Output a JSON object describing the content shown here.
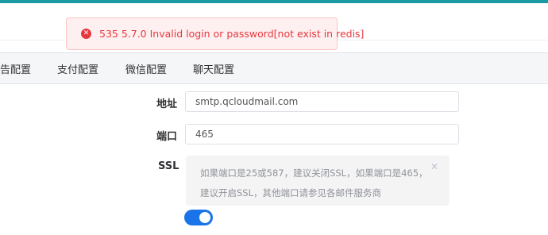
{
  "message": {
    "text": "535 5.7.0 Invalid login or password[not exist in redis]",
    "icon": "error-circle-icon",
    "color": "#e6393f"
  },
  "tabs": [
    {
      "label": "告配置"
    },
    {
      "label": "支付配置"
    },
    {
      "label": "微信配置"
    },
    {
      "label": "聊天配置"
    }
  ],
  "form": {
    "address": {
      "label": "地址",
      "value": "smtp.qcloudmail.com"
    },
    "port": {
      "label": "端口",
      "value": "465"
    },
    "ssl": {
      "label": "SSL",
      "hint": "如果端口是25或587，建议关闭SSL，如果端口是465，建议开启SSL，其他端口请参见各邮件服务商",
      "close_icon": "close-icon",
      "enabled": true
    }
  },
  "colors": {
    "accent": "#1a73e8",
    "top_bar": "#1a9aa2"
  }
}
